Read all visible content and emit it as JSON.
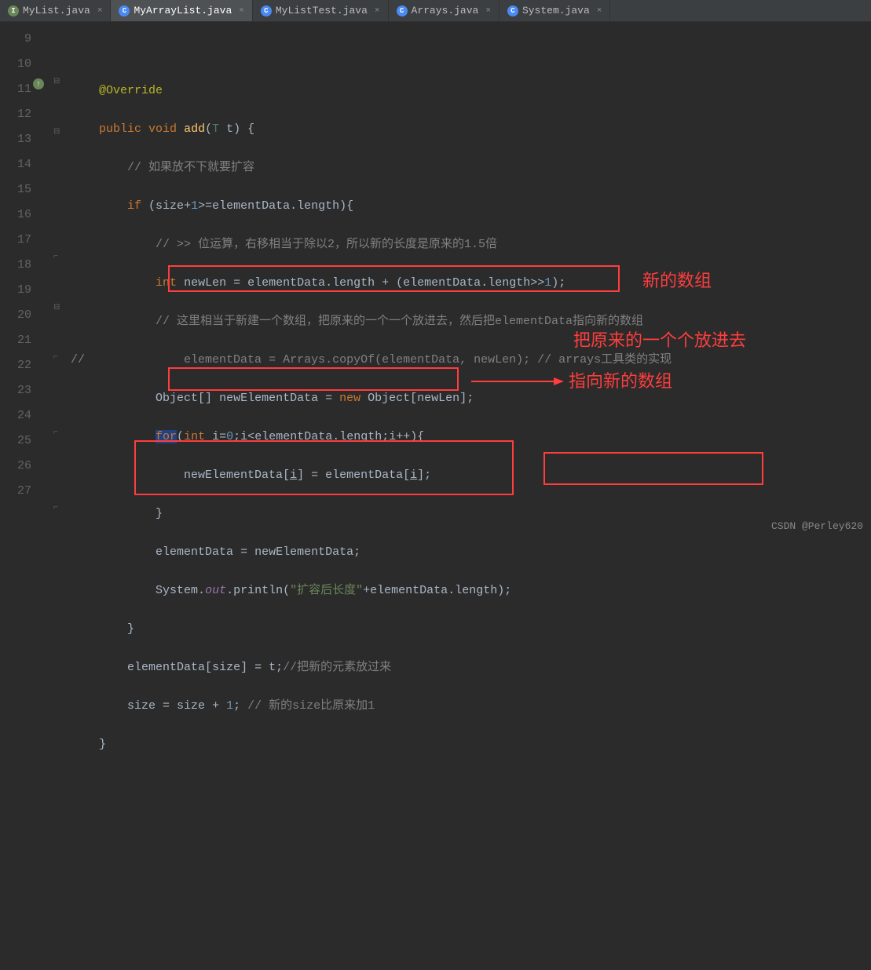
{
  "tabs": [
    {
      "icon": "I",
      "label": "MyList.java",
      "active": false
    },
    {
      "icon": "C",
      "label": "MyArrayList.java",
      "active": true
    },
    {
      "icon": "C",
      "label": "MyListTest.java",
      "active": false
    },
    {
      "icon": "C",
      "label": "Arrays.java",
      "active": false
    },
    {
      "icon": "C",
      "label": "System.java",
      "active": false
    }
  ],
  "line_start": 9,
  "line_end": 27,
  "code": {
    "l10": {
      "ann": "@Override"
    },
    "l11": {
      "kw1": "public",
      "kw2": "void",
      "method": "add",
      "gen": "T",
      "param": "t"
    },
    "l12": {
      "c": "// 如果放不下就要扩容"
    },
    "l13": {
      "kw": "if",
      "v1": "size",
      "op": "+",
      "n": "1",
      "cmp": ">=",
      "v2": "elementData",
      "f": "length"
    },
    "l14": {
      "c": "// >> 位运算，右移相当于除以2，所以新的长度是原来的1.5倍"
    },
    "l15": {
      "kw": "int",
      "v": "newLen",
      "a": "elementData",
      "f": "length",
      "b": "elementData",
      "f2": "length",
      "n": "1"
    },
    "l16": {
      "c": "// 这里相当于新建一个数组，把原来的一个一个放进去，然后把elementData指向新的数组"
    },
    "l17": {
      "pre": "//",
      "code": "elementData = Arrays.copyOf(elementData, newLen);",
      "c": "// arrays工具类的实现"
    },
    "l18": {
      "t": "Object",
      "v": "newElementData",
      "kw": "new",
      "t2": "Object",
      "arg": "newLen"
    },
    "l19": {
      "kw": "for",
      "kw2": "int",
      "v": "i",
      "n": "0",
      "a": "elementData",
      "f": "length"
    },
    "l20": {
      "dst": "newElementData",
      "idx": "i",
      "src": "elementData",
      "idx2": "i"
    },
    "l22": {
      "dst": "elementData",
      "src": "newElementData"
    },
    "l23": {
      "obj": "System",
      "field": "out",
      "m": "println",
      "str": "\"扩容后长度\"",
      "a": "elementData",
      "f": "length"
    },
    "l25": {
      "a": "elementData",
      "idx": "size",
      "v": "t",
      "c": "//把新的元素放过来"
    },
    "l26": {
      "v": "size",
      "n": "1",
      "c": "// 新的size比原来加1"
    }
  },
  "annotations": {
    "a1": "新的数组",
    "a2": "把原来的一个个放进去",
    "a3": "指向新的数组"
  },
  "watermark": "CSDN @Perley620"
}
